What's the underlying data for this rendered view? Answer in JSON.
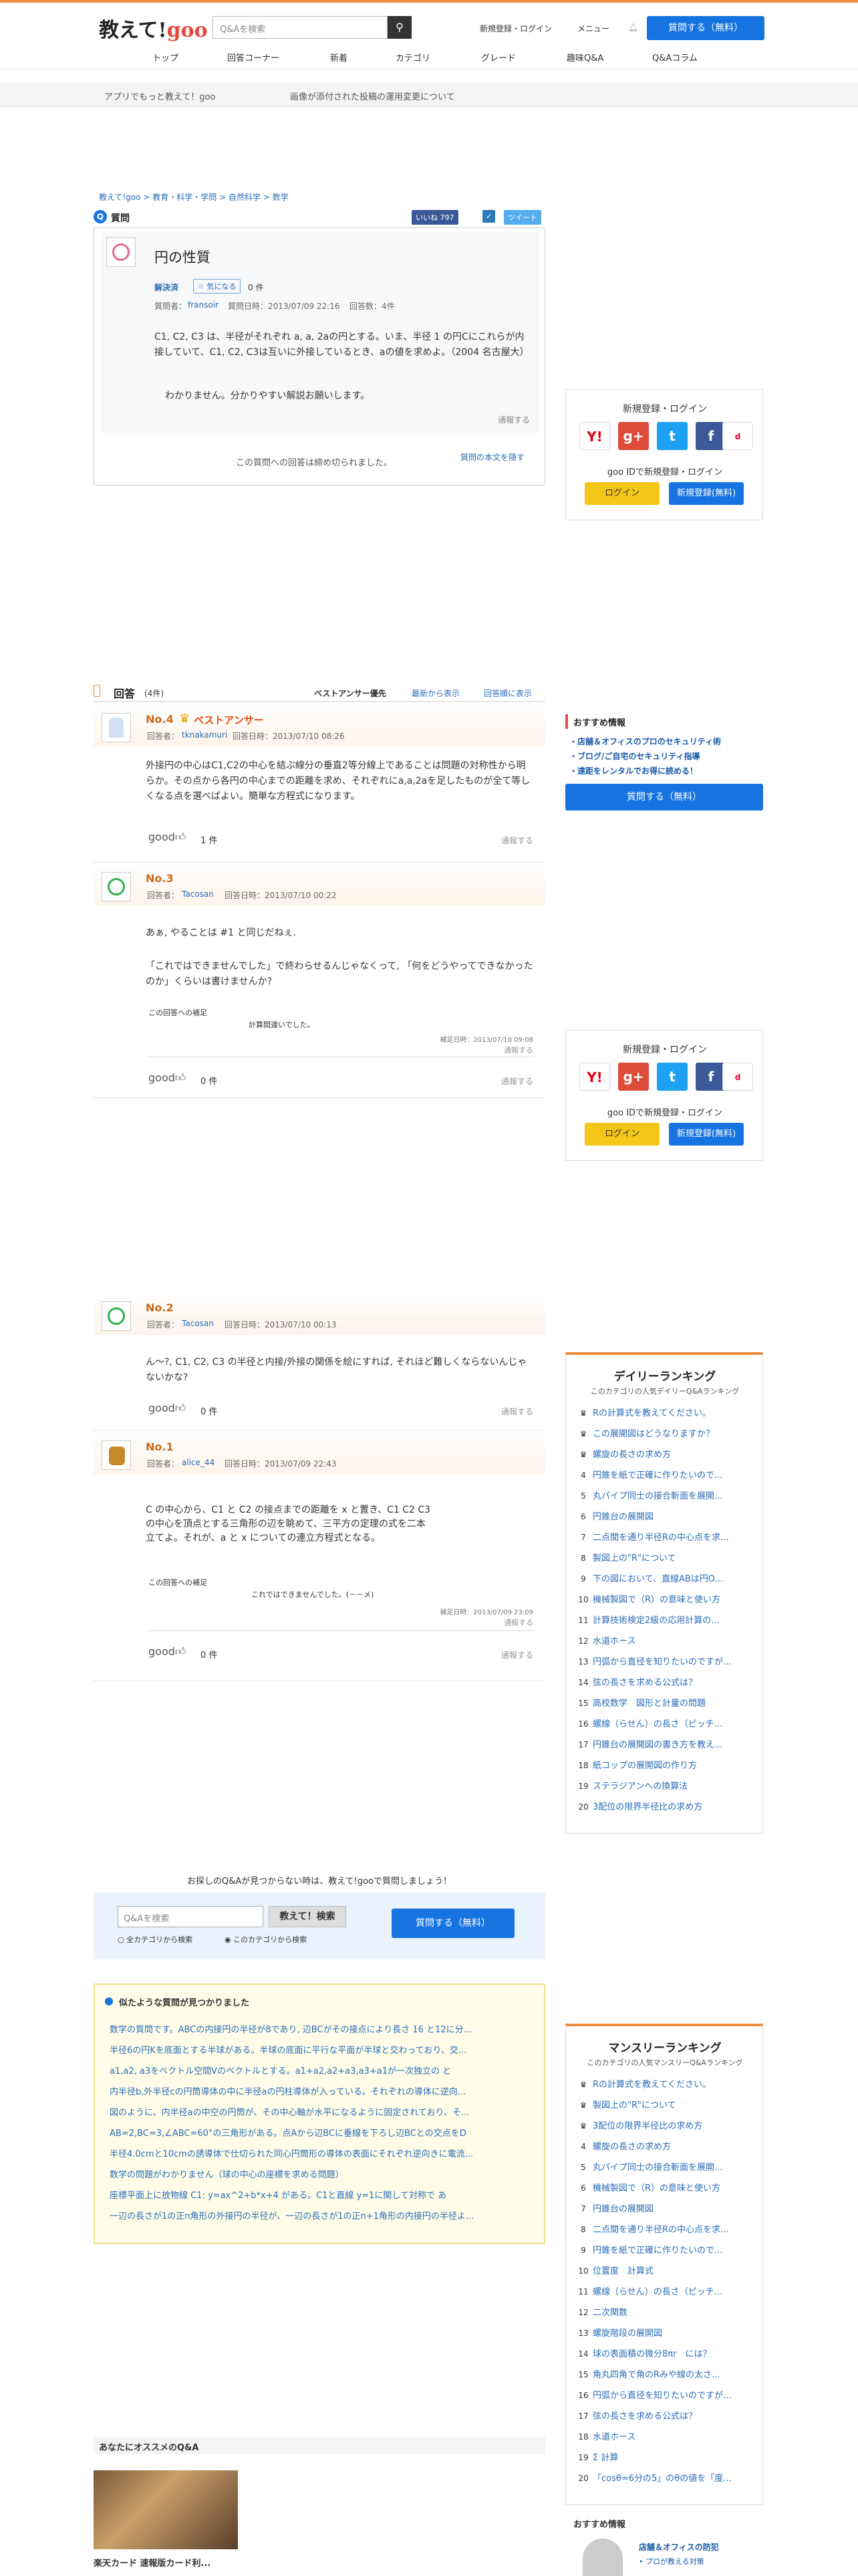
{
  "header": {
    "logo_text": "教えて!",
    "logo_goo": "goo",
    "search_placeholder": "Q&Aを検索",
    "links": [
      "新規登録・ログイン",
      "メニュー"
    ],
    "ask_button": "質問する（無料）"
  },
  "nav": [
    "トップ",
    "回答コーナー",
    "新着",
    "カテゴリ",
    "グレード",
    "趣味Q&A",
    "Q&Aコラム"
  ],
  "subnav": [
    "アプリでもっと教えて！goo",
    "画像が添付された投稿の運用変更について"
  ],
  "breadcrumb": "教えて!goo > 教育・科学・学問 > 自然科学 > 数学",
  "question": {
    "section": "質問",
    "like_count": "いいね 797",
    "tweet": "ツイート",
    "title": "円の性質",
    "status": "解決済",
    "watch_label": "気になる",
    "watch_count": "0 件",
    "asker_label": "質問者：",
    "asker": "fransoir",
    "date": "質問日時：2013/07/09 22:16",
    "answer_count": "回答数：4件",
    "body1": "C1, C2, C3 は、半径がそれぞれ a, a, 2aの円とする。いま、半径 1 の円Cにこれらが内接していて、C1, C2, C3は互いに外接しているとき、aの値を求めよ。（2004 名古屋大）",
    "body2": "わかりません。分かりやすい解説お願いします。",
    "report": "通報する",
    "closed": "この質問への回答は締め切られました。",
    "original": "質問の本文を隠す"
  },
  "side_login": {
    "title": "新規登録・ログイン",
    "sub": "goo IDで新規登録・ログイン",
    "login": "ログイン",
    "register": "新規登録(無料)"
  },
  "answers_header": {
    "title": "回答",
    "count": "(4件)",
    "sort_best": "ベストアンサー優先",
    "sort_new": "最新から表示",
    "sort_old": "回答順に表示"
  },
  "answers": [
    {
      "no": "No.4",
      "best": "ベストアンサー",
      "user": "tknakamuri",
      "date": "回答日時：2013/07/10 08:26",
      "body": "外接円の中心はC1,C2の中心を結ぶ線分の垂直2等分線上であることは問題の対称性から明らか。その点から各円の中心までの距離を求め、それぞれにa,a,2aを足したものが全て等しくなる点を選べばよい。簡単な方程式になります。",
      "good": "1 件"
    },
    {
      "no": "No.3",
      "user": "Tacosan",
      "date": "回答日時：2013/07/10 00:22",
      "body": "あぁ, やることは #1 と同じだねぇ.",
      "body2": "「これではできませんでした」で終わらせるんじゃなくって, 「何をどうやってできなかったのか」くらいは書けませんか?",
      "supp_label": "この回答への補足",
      "supp": "計算間違いでした。",
      "supp_date": "補足日時：2013/07/10 09:08",
      "good": "0 件"
    },
    {
      "no": "No.2",
      "user": "Tacosan",
      "date": "回答日時：2013/07/10 00:13",
      "body": "ん〜?, C1, C2, C3 の半径と内接/外接の関係を絵にすれば, それほど難しくならないんじゃないかな?",
      "good": "0 件"
    },
    {
      "no": "No.1",
      "user": "alice_44",
      "date": "回答日時：2013/07/09 22:43",
      "body": "C の中心から、C1 と C2 の接点までの距離を x と置き、C1 C2 C3 の中心を頂点とする三角形の辺を眺めて、三平方の定理の式を二本立てよ。それが、a と x についての連立方程式となる。",
      "supp_label": "この回答への補足",
      "supp": "これではできませんでした。(－－メ)",
      "supp_date": "補足日時：2013/07/09 23:09",
      "good": "0 件"
    }
  ],
  "answerer_label": "回答者：",
  "report": "通報する",
  "good_label": "good",
  "recommend": {
    "title": "おすすめ情報",
    "items": [
      "店舗＆オフィスのプロのセキュリティ術",
      "ブログ/ご自宅のセキュリティ指導",
      "遠距をレンタルでお得に読める！"
    ]
  },
  "daily_ranking": {
    "title": "デイリーランキング",
    "sub": "このカテゴリの人気デイリーQ&Aランキング",
    "items": [
      "Rの計算式を教えてください。",
      "この展開図はどうなりますか？",
      "螺旋の長さの求め方",
      "円錐を紙で正確に作りたいので...",
      "丸パイプ同士の接合斬面を展開...",
      "円錐台の展開図",
      "二点間を通り半径Rの中心点を求...",
      "製図上の\"R\"について",
      "下の図において、直線ABは円O...",
      "機械製図で（R）の意味と使い方",
      "計算技術検定2級の応用計算の...",
      "水道ホース",
      "円弧から直径を知りたいのですが...",
      "弦の長さを求める公式は？",
      "高校数学　図形と計量の問題",
      "螺線（らせん）の長さ（ピッチ...",
      "円錐台の展開図の書き方を教え...",
      "紙コップの展開図の作り方",
      "ステラジアンへの換算法",
      "3配位の限界半径比の求め方"
    ]
  },
  "bottom_search": {
    "notice": "お探しのQ&Aが見つからない時は、教えて!gooで質問しましょう！",
    "placeholder": "Q&Aを検索",
    "button": "教えて！検索",
    "opt_all": "全カテゴリから検索",
    "opt_this": "このカテゴリから検索",
    "ask": "質問する（無料）"
  },
  "similar": {
    "title": "似たような質問が見つかりました",
    "items": [
      "数学の質問です。ABCの内接円の半径が8であり, 辺BCがその接点により長さ 16 と12に分...",
      "半径6の円Kを底面とする半球がある。半球の底面に平行な平面が半球と交わっており、交...",
      "a1,a2, a3をベクトル空間Vのベクトルとする。a1+a2,a2+a3,a3+a1が一次独立の と",
      "内半径b,外半径cの円筒導体の中に半径aの円柱導体が入っている。それぞれの導体に逆向...",
      "図のように、内半径aの中空の円筒が、その中心軸が水平になるように固定されており、そ...",
      "AB=2,BC=3,∠ABC=60°の三角形がある。点Aから辺BCに垂線を下ろし辺BCとの交点をD",
      "半径4.0cmと10cmの誘導体で仕切られた同心円筒形の導体の表面にそれぞれ逆向きに電流...",
      "数学の問題がわかりません（球の中心の座標を求める問題）",
      "座標平面上に放物線 C1: y=ax^2+b*x+4 がある。C1と直線 y=1に関して対称で あ",
      "一辺の長さが1の正n角形の外接円の半径が、一辺の長さが1の正n+1角形の内接円の半径よ..."
    ]
  },
  "monthly_ranking": {
    "title": "マンスリーランキング",
    "sub": "このカテゴリの人気マンスリーQ&Aランキング",
    "items": [
      "Rの計算式を教えてください。",
      "製図上の\"R\"について",
      "3配位の限界半径比の求め方",
      "螺旋の長さの求め方",
      "丸パイプ同士の接合斬面を展開...",
      "機械製図で（R）の意味と使い方",
      "円錐台の展開図",
      "二点間を通り半径Rの中心点を求...",
      "円錐を紙で正確に作りたいので...",
      "位置度　計算式",
      "螺線（らせん）の長さ（ピッチ...",
      "二次関数",
      "螺旋階段の展開図",
      "球の表面積の微分8πr　には？",
      "角丸四角で角のRみや線の太さ...",
      "円弧から直径を知りたいのですが...",
      "弦の長さを求める公式は？",
      "水道ホース",
      "Σ 計算",
      "「cosθ=6分の5」のθの値を「度..."
    ]
  },
  "recommend_qa": {
    "title": "あなたにオススメのQ&A",
    "item": "楽天カード 速報版カード利..."
  },
  "recommend_info2": {
    "title": "おすすめ情報",
    "item1": "店舗＆オフィスの防犯",
    "item2": "プロが教える対策"
  }
}
